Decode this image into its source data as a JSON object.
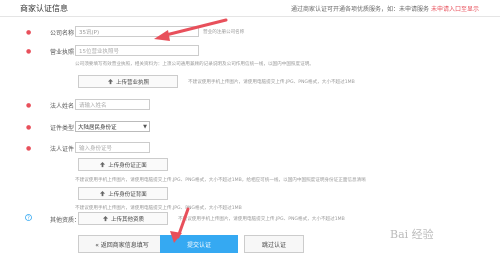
{
  "header": {
    "title": "商家认证信息",
    "hint": "通过商家认证可开通各项优质服务，如：未申请服务",
    "hint_link": "未申请入口至显示"
  },
  "form": {
    "company": {
      "label": "公司名称：",
      "value": "35讯(P)",
      "note": "营业的注册公司名称"
    },
    "license": {
      "label": "营业执照：",
      "placeholder": "15位营业执照号"
    },
    "license_note": "公司须要填写有效营业执照，相关资料为：上须公司通用兼顾的记录说明及公司作用信统一线，以国内中国照度证明。",
    "license_upload": {
      "label": "上传营业执照",
      "note": "不建议使用手机上传图片，请使用电脑提交上传.JPG、PNG格式，大小不超过1MB"
    },
    "legal_name": {
      "label": "法人姓名：",
      "placeholder": "请输入姓名"
    },
    "id_type": {
      "label": "证件类型：",
      "value": "大陆居民身份证"
    },
    "id_number": {
      "label": "法人证件：",
      "placeholder": "输入身份证号"
    },
    "id_front": {
      "label": "上传身份证正面",
      "note": "不建议使用手机上传图片，请使用电脑提交上传.JPG、PNG格式，大小不超过1MB，给相应可统一线，以国内中国照度证明身份证正面信息清晰"
    },
    "id_back": {
      "label": "上传身份证背面",
      "note": "不建议使用手机上传图片，请使用电脑提交上传.JPG、PNG格式，大小不超过1MB"
    },
    "other": {
      "label": "其他资质：",
      "upload": "上传其他资质",
      "note": "不建议使用手机上传图片，请使用电脑提交上传.JPG、PNG格式，大小不超过1MB"
    }
  },
  "actions": {
    "back": "« 返回商家信息填写",
    "submit": "提交认证",
    "skip": "跳过认证"
  },
  "watermark": "Bai 经验",
  "colors": {
    "accent": "#35a9f2",
    "required": "#e8505b",
    "pointer": "#e8505b"
  }
}
